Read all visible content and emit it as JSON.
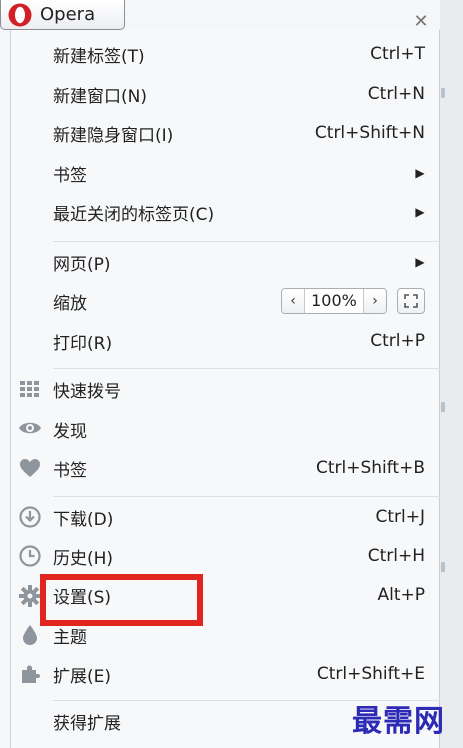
{
  "app": {
    "button_label": "Opera"
  },
  "menu": {
    "items": [
      {
        "label": "新建标签(T)",
        "shortcut": "Ctrl+T"
      },
      {
        "label": "新建窗口(N)",
        "shortcut": "Ctrl+N"
      },
      {
        "label": "新建隐身窗口(I)",
        "shortcut": "Ctrl+Shift+N"
      },
      {
        "label": "书签",
        "shortcut": ""
      },
      {
        "label": "最近关闭的标签页(C)",
        "shortcut": ""
      },
      {
        "label": "网页(P)",
        "shortcut": ""
      },
      {
        "label": "缩放",
        "shortcut": ""
      },
      {
        "label": "打印(R)",
        "shortcut": "Ctrl+P"
      },
      {
        "label": "快速拨号",
        "shortcut": ""
      },
      {
        "label": "发现",
        "shortcut": ""
      },
      {
        "label": "书签",
        "shortcut": "Ctrl+Shift+B"
      },
      {
        "label": "下载(D)",
        "shortcut": "Ctrl+J"
      },
      {
        "label": "历史(H)",
        "shortcut": "Ctrl+H"
      },
      {
        "label": "设置(S)",
        "shortcut": "Alt+P"
      },
      {
        "label": "主题",
        "shortcut": ""
      },
      {
        "label": "扩展(E)",
        "shortcut": "Ctrl+Shift+E"
      },
      {
        "label": "获得扩展",
        "shortcut": ""
      }
    ],
    "zoom": {
      "value": "100%",
      "decrease_symbol": "‹",
      "increase_symbol": "›"
    }
  },
  "icons": {
    "opera_logo": "opera-logo-icon",
    "close": "close-icon",
    "speed_dial": "speed-dial-icon",
    "discover": "eye-icon",
    "bookmarks": "heart-icon",
    "downloads": "download-icon",
    "history": "clock-icon",
    "settings": "gear-icon",
    "themes": "droplet-icon",
    "extensions": "puzzle-icon",
    "fullscreen": "fullscreen-icon"
  },
  "colors": {
    "highlight": "#e0261e",
    "opera_red": "#d21f26",
    "watermark": "#2d2ab6"
  },
  "watermark": {
    "text": "最需网"
  }
}
